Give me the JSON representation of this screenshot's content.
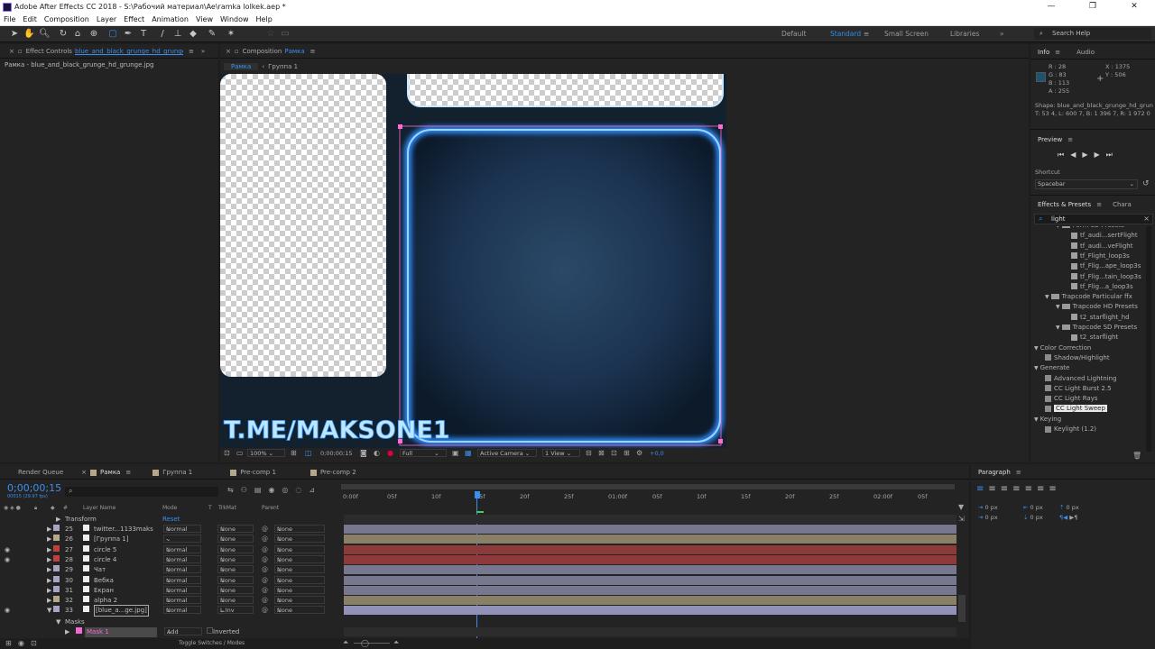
{
  "window": {
    "title": "Adobe After Effects CC 2018 - S:\\Рабочий материал\\Ae\\ramka lolkek.aep *"
  },
  "menu": [
    "File",
    "Edit",
    "Composition",
    "Layer",
    "Effect",
    "Animation",
    "View",
    "Window",
    "Help"
  ],
  "workspaces": {
    "default": "Default",
    "standard": "Standard",
    "small": "Small Screen",
    "libraries": "Libraries"
  },
  "search_help": {
    "placeholder": "Search Help"
  },
  "effect_controls": {
    "tab_prefix": "Effect Controls",
    "tab_layer": "blue_and_black_grunge_hd_grunge.jpg",
    "subheader": "Рамка - blue_and_black_grunge_hd_grunge.jpg"
  },
  "composition": {
    "tab_prefix": "Composition",
    "tab_name": "Рамка",
    "breadcrumb_active": "Рамка",
    "breadcrumb_next": "Группа 1",
    "overlay_text": "T.ME/MAKSONE1"
  },
  "viewer_bar": {
    "zoom": "100%",
    "time": "0;00;00;15",
    "resolution": "Full",
    "camera": "Active Camera",
    "views": "1 View",
    "exposure": "+0,0"
  },
  "info": {
    "tab": "Info",
    "audio_tab": "Audio",
    "r": "R : 28",
    "g": "G : 83",
    "b": "B : 113",
    "a": "A : 255",
    "x": "X : 1375",
    "y": "Y : 506",
    "shape_line1": "Shape: blue_and_black_grunge_hd_grun",
    "shape_line2": "T: 53 4, L: 600 7, B: 1 396 7, R: 1 972 0",
    "swatch_color": "#1c5371"
  },
  "preview": {
    "title": "Preview",
    "shortcut_label": "Shortcut",
    "shortcut_value": "Spacebar"
  },
  "effects": {
    "tab": "Effects & Presets",
    "tab2": "Chara",
    "search_value": "light",
    "items": [
      {
        "indent": 2,
        "kind": "folder",
        "label": "Form SD Presets"
      },
      {
        "indent": 3,
        "kind": "preset",
        "label": "tf_audi...sertFlight"
      },
      {
        "indent": 3,
        "kind": "preset",
        "label": "tf_audi...veFlight"
      },
      {
        "indent": 3,
        "kind": "preset",
        "label": "tf_Flight_loop3s"
      },
      {
        "indent": 3,
        "kind": "preset",
        "label": "tf_Flig...ape_loop3s"
      },
      {
        "indent": 3,
        "kind": "preset",
        "label": "tf_Flig...tain_loop3s"
      },
      {
        "indent": 3,
        "kind": "preset",
        "label": "tf_Flig...a_loop3s"
      },
      {
        "indent": 1,
        "kind": "folder",
        "label": "Trapcode Particular ffx"
      },
      {
        "indent": 2,
        "kind": "folder",
        "label": "Trapcode HD Presets"
      },
      {
        "indent": 3,
        "kind": "preset",
        "label": "t2_starflight_hd"
      },
      {
        "indent": 2,
        "kind": "folder",
        "label": "Trapcode SD Presets"
      },
      {
        "indent": 3,
        "kind": "preset",
        "label": "t2_starflight"
      },
      {
        "indent": 0,
        "kind": "category",
        "label": "Color Correction"
      },
      {
        "indent": 1,
        "kind": "effect",
        "label": "Shadow/Highlight"
      },
      {
        "indent": 0,
        "kind": "category",
        "label": "Generate"
      },
      {
        "indent": 1,
        "kind": "effect",
        "label": "Advanced Lightning"
      },
      {
        "indent": 1,
        "kind": "effect",
        "label": "CC Light Burst 2.5"
      },
      {
        "indent": 1,
        "kind": "effect",
        "label": "CC Light Rays"
      },
      {
        "indent": 1,
        "kind": "effect",
        "label": "CC Light Sweep",
        "selected": true
      },
      {
        "indent": 0,
        "kind": "category",
        "label": "Keying"
      },
      {
        "indent": 1,
        "kind": "effect",
        "label": "Keylight (1.2)"
      }
    ]
  },
  "timeline": {
    "tabs": [
      "Render Queue",
      "Рамка",
      "Группа 1",
      "Pre-comp 1",
      "Pre-comp 2"
    ],
    "timecode": "0;00;00;15",
    "timecode_sub": "00015 (29.97 fps)",
    "columns": {
      "num": "#",
      "name": "Layer Name",
      "mode": "Mode",
      "t": "T",
      "trkmat": "TrkMat",
      "parent": "Parent"
    },
    "ruler": [
      "0:00f",
      "05f",
      "10f",
      "15f",
      "20f",
      "25f",
      "01:00f",
      "05f",
      "10f",
      "15f",
      "20f",
      "25f",
      "02:00f",
      "05f"
    ],
    "transform_label": "Transform",
    "reset_label": "Reset",
    "layers": [
      {
        "num": "25",
        "name": "twitter...1133maks",
        "mode": "Normal",
        "trkmat": "None",
        "parent": "None",
        "color": "#a6a6c4",
        "bar": "#777790"
      },
      {
        "num": "26",
        "name": "[Группа 1]",
        "mode": "-",
        "trkmat": "None",
        "parent": "None",
        "color": "#b5a88a",
        "bar": "#8a8068"
      },
      {
        "num": "27",
        "name": "circle 5",
        "mode": "Normal",
        "trkmat": "None",
        "parent": "None",
        "color": "#c04040",
        "bar": "#8f3a3a"
      },
      {
        "num": "28",
        "name": "circle 4",
        "mode": "Normal",
        "trkmat": "None",
        "parent": "None",
        "color": "#c04040",
        "bar": "#8f3a3a"
      },
      {
        "num": "29",
        "name": "Чат",
        "mode": "Normal",
        "trkmat": "None",
        "parent": "None",
        "color": "#a6a6c4",
        "bar": "#777790"
      },
      {
        "num": "30",
        "name": "Вебка",
        "mode": "Normal",
        "trkmat": "None",
        "parent": "None",
        "color": "#a6a6c4",
        "bar": "#777790"
      },
      {
        "num": "31",
        "name": "Екран",
        "mode": "Normal",
        "trkmat": "None",
        "parent": "None",
        "color": "#a6a6c4",
        "bar": "#777790"
      },
      {
        "num": "32",
        "name": "alpha 2",
        "mode": "Normal",
        "trkmat": "None",
        "parent": "None",
        "color": "#b5a88a",
        "bar": "#8a8068"
      },
      {
        "num": "33",
        "name": "[blue_a...ge.jpg]",
        "mode": "Normal",
        "trkmat": "L.Inv",
        "parent": "None",
        "color": "#a6a6c4",
        "bar": "#9292b8"
      }
    ],
    "masks_label": "Masks",
    "mask1_label": "Mask 1",
    "mask_mode": "Add",
    "mask_inverted": "Inverted",
    "toggle_label": "Toggle Switches / Modes"
  },
  "paragraph": {
    "title": "Paragraph",
    "px0": "0 px"
  }
}
